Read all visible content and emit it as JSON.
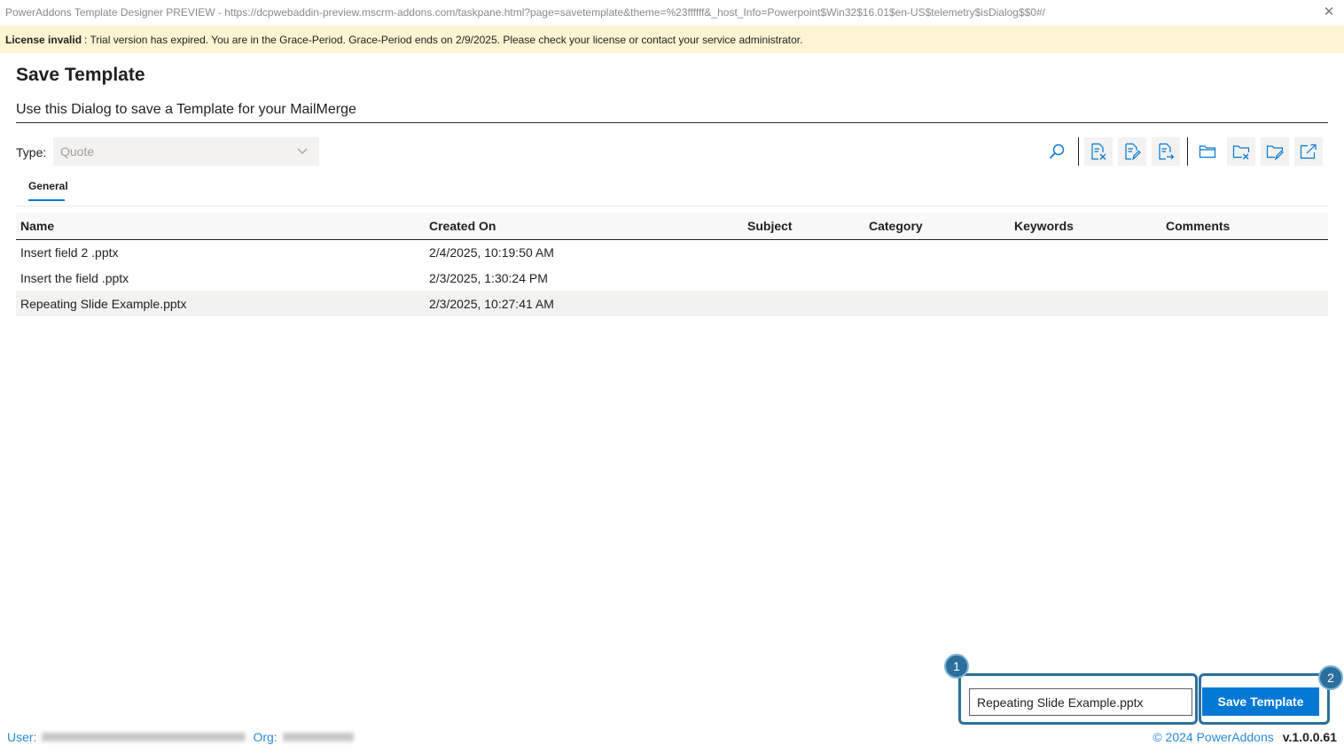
{
  "window": {
    "title": "PowerAddons Template Designer PREVIEW - https://dcpwebaddin-preview.mscrm-addons.com/taskpane.html?page=savetemplate&theme=%23ffffff&_host_Info=Powerpoint$Win32$16.01$en-US$telemetry$isDialog$$0#/",
    "close_symbol": "✕"
  },
  "license": {
    "label": "License invalid",
    "message": ": Trial version has expired. You are in the Grace-Period. Grace-Period ends on 2/9/2025. Please check your license or contact your service administrator."
  },
  "dialog": {
    "title": "Save Template",
    "subtitle": "Use this Dialog to save a Template for your MailMerge"
  },
  "type_filter": {
    "label": "Type:",
    "value": "Quote"
  },
  "toolbar": {
    "icons": [
      "search-icon",
      "delete-document-icon",
      "edit-document-icon",
      "export-document-icon",
      "folder-icon",
      "delete-folder-icon",
      "edit-folder-icon",
      "open-external-icon"
    ]
  },
  "tabs": [
    {
      "label": "General",
      "active": true
    }
  ],
  "table": {
    "columns": [
      "Name",
      "Created On",
      "Subject",
      "Category",
      "Keywords",
      "Comments"
    ],
    "rows": [
      {
        "name": "Insert field 2 .pptx",
        "created_on": "2/4/2025, 10:19:50 AM",
        "subject": "",
        "category": "",
        "keywords": "",
        "comments": ""
      },
      {
        "name": "Insert the field .pptx",
        "created_on": "2/3/2025, 1:30:24 PM",
        "subject": "",
        "category": "",
        "keywords": "",
        "comments": ""
      },
      {
        "name": "Repeating Slide Example.pptx",
        "created_on": "2/3/2025, 10:27:41 AM",
        "subject": "",
        "category": "",
        "keywords": "",
        "comments": ""
      }
    ]
  },
  "save": {
    "filename_value": "Repeating Slide Example.pptx",
    "button_label": "Save Template"
  },
  "annotations": {
    "badge1": "1",
    "badge2": "2",
    "color": "#2c6f9c"
  },
  "footer": {
    "user_label": "User:",
    "org_label": "Org:",
    "copyright": "© 2024 PowerAddons",
    "version": "v.1.0.0.61"
  },
  "colors": {
    "accent": "#0078d4",
    "license_banner": "#fdf4d3",
    "link": "#2b88d8"
  }
}
